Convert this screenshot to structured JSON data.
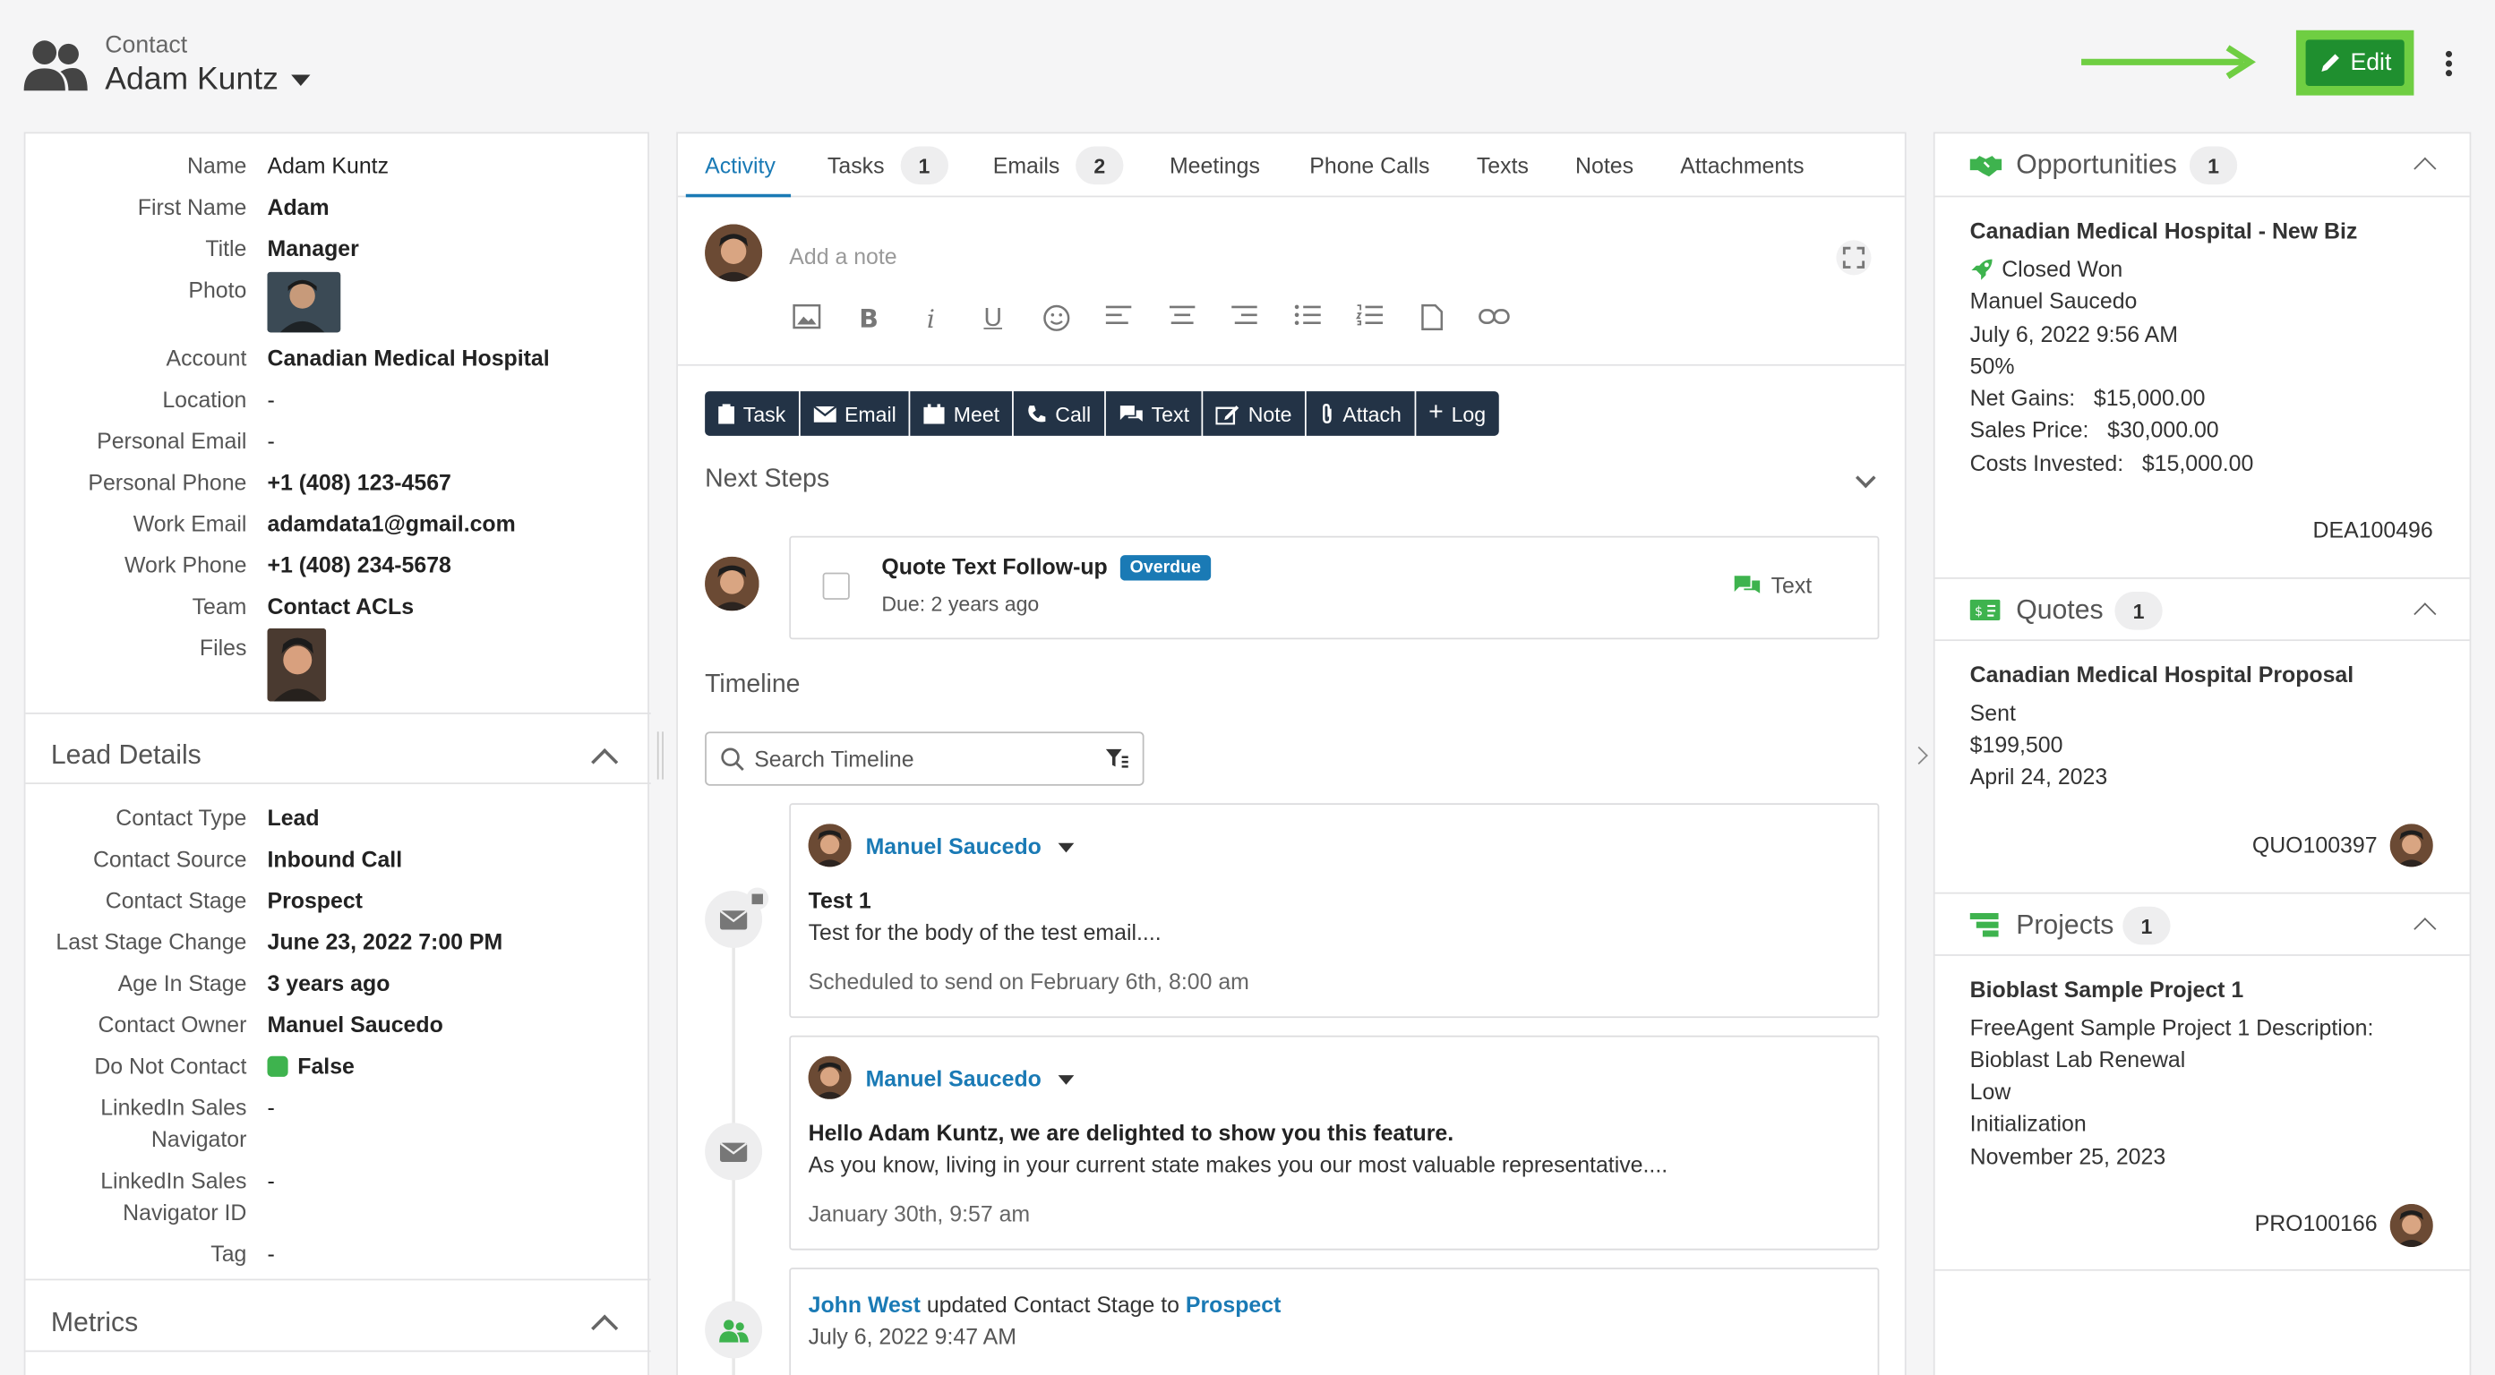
{
  "header": {
    "subtitle": "Contact",
    "title": "Adam Kuntz",
    "edit_label": "Edit"
  },
  "left": {
    "fields": [
      {
        "label": "Name",
        "value": "Adam Kuntz",
        "style": "link"
      },
      {
        "label": "First Name",
        "value": "Adam",
        "style": "bold"
      },
      {
        "label": "Title",
        "value": "Manager",
        "style": "bold"
      },
      {
        "label": "Photo",
        "value": ""
      },
      {
        "label": "Account",
        "value": "Canadian Medical Hospital",
        "style": "link"
      },
      {
        "label": "Location",
        "value": "-"
      },
      {
        "label": "Personal Email",
        "value": "-"
      },
      {
        "label": "Personal Phone",
        "value": "+1 (408) 123-4567",
        "style": "link"
      },
      {
        "label": "Work Email",
        "value": "adamdata1@gmail.com",
        "style": "link"
      },
      {
        "label": "Work Phone",
        "value": "+1 (408) 234-5678",
        "style": "link"
      },
      {
        "label": "Team",
        "value": "Contact ACLs",
        "style": "bold"
      },
      {
        "label": "Files",
        "value": ""
      }
    ],
    "lead_section_title": "Lead Details",
    "lead_fields": [
      {
        "label": "Contact Type",
        "value": "Lead",
        "style": "bold"
      },
      {
        "label": "Contact Source",
        "value": "Inbound Call",
        "style": "bold"
      },
      {
        "label": "Contact Stage",
        "value": "Prospect",
        "style": "link"
      },
      {
        "label": "Last Stage Change",
        "value": "June 23, 2022 7:00 PM",
        "style": "bold"
      },
      {
        "label": "Age In Stage",
        "value": "3 years ago",
        "style": "bold"
      },
      {
        "label": "Contact Owner",
        "value": "Manuel Saucedo",
        "style": "link"
      },
      {
        "label": "Do Not Contact",
        "value": "False",
        "style": "bold"
      },
      {
        "label": "LinkedIn Sales Navigator",
        "value": "-"
      },
      {
        "label": "LinkedIn Sales Navigator ID",
        "value": "-"
      },
      {
        "label": "Tag",
        "value": "-"
      }
    ],
    "metrics_title": "Metrics"
  },
  "mid": {
    "tabs": [
      {
        "label": "Activity",
        "count": ""
      },
      {
        "label": "Tasks",
        "count": "1"
      },
      {
        "label": "Emails",
        "count": "2"
      },
      {
        "label": "Meetings",
        "count": ""
      },
      {
        "label": "Phone Calls",
        "count": ""
      },
      {
        "label": "Texts",
        "count": ""
      },
      {
        "label": "Notes",
        "count": ""
      },
      {
        "label": "Attachments",
        "count": ""
      }
    ],
    "note_placeholder": "Add a note",
    "actions": [
      "Task",
      "Email",
      "Meet",
      "Call",
      "Text",
      "Note",
      "Attach",
      "Log"
    ],
    "next_steps_title": "Next Steps",
    "task": {
      "title": "Quote Text Follow-up",
      "badge": "Overdue",
      "due": "Due: 2 years ago",
      "action": "Text"
    },
    "timeline_title": "Timeline",
    "search_placeholder": "Search Timeline",
    "entries": [
      {
        "author": "Manuel Saucedo",
        "subject": "Test 1",
        "body": "Test for the body of the test email....",
        "meta": "Scheduled to send on February 6th, 8:00 am"
      },
      {
        "author": "Manuel Saucedo",
        "subject": "Hello Adam Kuntz, we are delighted to show you this feature.",
        "body": "As you know, living in your current state makes you our most valuable representative....",
        "meta": "January 30th, 9:57 am"
      }
    ],
    "update": {
      "actor": "John West",
      "text": "updated Contact Stage to",
      "stage": "Prospect",
      "date": "July 6, 2022 9:47 AM"
    }
  },
  "right": {
    "opportunities": {
      "title": "Opportunities",
      "count": "1",
      "name": "Canadian Medical Hospital - New Biz",
      "status": "Closed Won",
      "owner": "Manuel Saucedo",
      "date": "July 6, 2022 9:56 AM",
      "probability": "50%",
      "net_gains": "Net Gains:   $15,000.00",
      "sales_price": "Sales Price:   $30,000.00",
      "costs": "Costs Invested:   $15,000.00",
      "id": "DEA100496"
    },
    "quotes": {
      "title": "Quotes",
      "count": "1",
      "name": "Canadian Medical Hospital Proposal",
      "status": "Sent",
      "amount": "$199,500",
      "date": "April 24, 2023",
      "id": "QUO100397"
    },
    "projects": {
      "title": "Projects",
      "count": "1",
      "name": "Bioblast Sample Project 1",
      "description": "FreeAgent Sample Project 1 Description:",
      "line2": "Bioblast Lab Renewal",
      "priority": "Low",
      "stage": "Initialization",
      "date": "November 25, 2023",
      "id": "PRO100166"
    }
  },
  "colors": {
    "accent": "#1a7ab5",
    "edit_button": "#1f8f2f",
    "highlight": "#6fce42",
    "action_bar": "#233346"
  }
}
